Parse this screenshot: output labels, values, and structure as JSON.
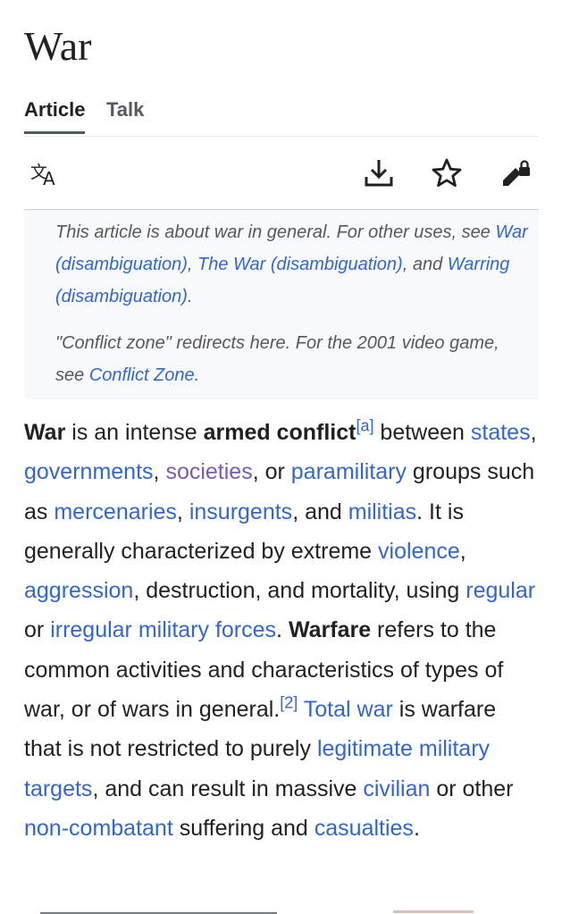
{
  "page_title": "War",
  "tabs": [
    {
      "label": "Article",
      "active": true
    },
    {
      "label": "Talk",
      "active": false
    }
  ],
  "toolbar": {
    "icons": [
      "language-icon",
      "download-icon",
      "watch-star-icon",
      "edit-locked-icon"
    ]
  },
  "hatnote": {
    "line1_prefix": "This article is about war in general. For other uses, see",
    "link1": "War (disambiguation)",
    "sep1": ",",
    "link2": "The War (disambiguation)",
    "sep2": ", and",
    "link3": "Warring (disambiguation)",
    "end1": ".",
    "line2_prefix": "\"Conflict zone\" redirects here. For the 2001 video game, see",
    "link4": "Conflict Zone",
    "end2": "."
  },
  "paragraph": {
    "b1": "War",
    "t1": " is an intense ",
    "b2": "armed conflict",
    "sup1": "[a]",
    "t2": " between ",
    "l_states": "states",
    "t3": ", ",
    "l_governments": "governments",
    "t4": ", ",
    "l_societies": "societies",
    "t5": ", or ",
    "l_paramilitary": "paramilitary",
    "t6": " groups such as ",
    "l_mercenaries": "mercenaries",
    "t7": ", ",
    "l_insurgents": "insurgents",
    "t8": ", and ",
    "l_militias": "militias",
    "t9": ". It is generally characterized by extreme ",
    "l_violence": "violence",
    "t10": ", ",
    "l_aggression": "aggression",
    "t11": ", destruction, and mortality, using ",
    "l_regular": "regular",
    "t12": " or ",
    "l_irregular": "irregular military forces",
    "t13": ". ",
    "b3": "Warfare",
    "t14": " refers to the common activities and characteristics of types of war, or of wars in general.",
    "sup2": "[2]",
    "t15": " ",
    "l_total": "Total war",
    "t16": " is warfare that is not restricted to purely ",
    "l_legit": "legitimate military targets",
    "t17": ", and can result in massive ",
    "l_civilian": "civilian",
    "t18": " or other ",
    "l_noncombatant": "non-combatant",
    "t19": " suffering and ",
    "l_casualties": "casualties",
    "t20": "."
  },
  "colors": {
    "link": "#3366cc",
    "visited_link": "#795cb2",
    "text": "#202122",
    "hatnote_bg": "#f8f9fa"
  }
}
